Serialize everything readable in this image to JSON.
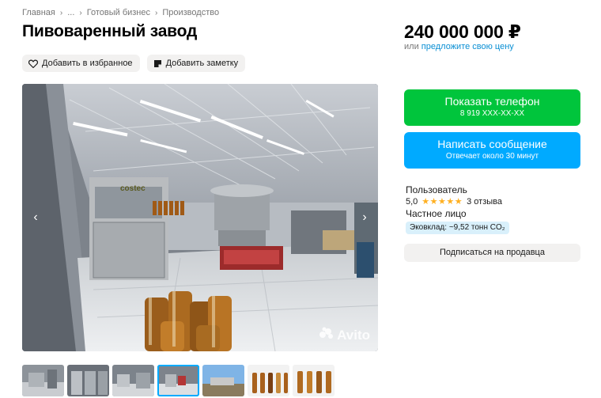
{
  "breadcrumb": {
    "items": [
      "Главная",
      "...",
      "Готовый бизнес",
      "Производство"
    ],
    "separator": "›"
  },
  "listing": {
    "title": "Пивоваренный завод",
    "price": "240 000 000 ₽",
    "price_or": "или",
    "price_offer_link": "предложите свою цену"
  },
  "actions": {
    "favorite": "Добавить в избранное",
    "note": "Добавить заметку"
  },
  "gallery": {
    "prev_arrow": "‹",
    "next_arrow": "›",
    "watermark": "Avito",
    "photo_label": "costec",
    "thumb_count": 7,
    "active_thumb": 4
  },
  "contact": {
    "phone_label": "Показать телефон",
    "phone_masked": "8 919 XXX-XX-XX",
    "message_label": "Написать сообщение",
    "message_sub": "Отвечает около 30 минут"
  },
  "seller": {
    "name": "Пользователь",
    "rating": "5,0",
    "stars": "★★★★★",
    "reviews": "3 отзыва",
    "type": "Частное лицо",
    "eco": "Эковклад: ~9,52 тонн CO₂",
    "subscribe": "Подписаться на продавца"
  },
  "colors": {
    "green": "#00c53c",
    "blue": "#00aaff",
    "link": "#0a8fd4",
    "star": "#ffb021"
  }
}
